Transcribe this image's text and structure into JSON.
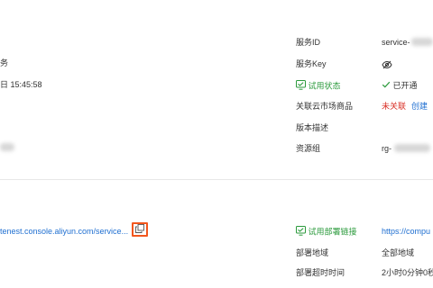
{
  "left": {
    "row1_fragment": "务",
    "row2_fragment": "日 15:45:58",
    "endpoint_url_fragment": "tenest.console.aliyun.com/service..."
  },
  "details": {
    "service_id": {
      "label": "服务ID",
      "value_prefix": "service-"
    },
    "service_key": {
      "label": "服务Key",
      "value_icon": "eye-off-icon"
    },
    "trial_status": {
      "label": "试用状态",
      "value": "已开通"
    },
    "marketplace_item": {
      "label": "关联云市场商品",
      "status": "未关联",
      "action": "创建"
    },
    "version_desc": {
      "label": "版本描述",
      "value": ""
    },
    "resource_group": {
      "label": "资源组",
      "value_prefix": "rg-"
    }
  },
  "deploy": {
    "trial_link": {
      "label": "试用部署链接",
      "value": "https://compu"
    },
    "region": {
      "label": "部署地域",
      "value": "全部地域"
    },
    "timeout": {
      "label": "部署超时时间",
      "value": "2小时0分钟0秒"
    }
  },
  "colors": {
    "accent_green": "#2b9a3c",
    "link_blue": "#1f6fd1",
    "alert_red": "#d93026",
    "highlight_orange": "#f2561d"
  }
}
